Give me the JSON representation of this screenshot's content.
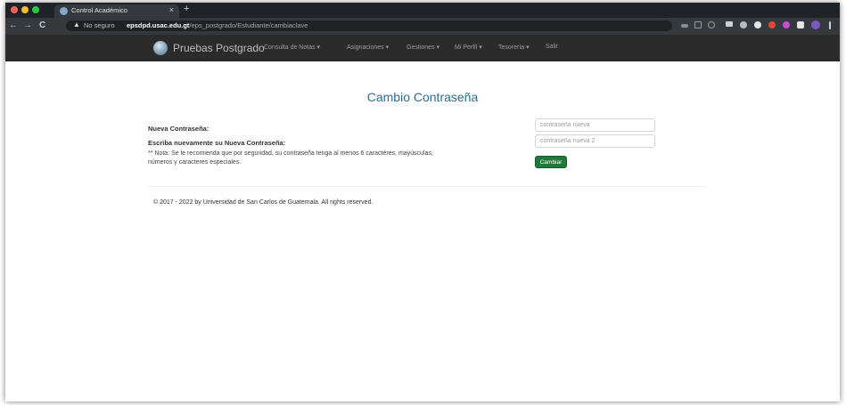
{
  "browser": {
    "tab_title": "Control Académico",
    "tab_close": "×",
    "new_tab": "+",
    "back": "←",
    "forward": "→",
    "reload": "C",
    "security_label": "No seguro",
    "url_host": "epsdpd.usac.edu.gt",
    "url_path": "/eps_postgrado/Estudiante/cambiaclave"
  },
  "navbar": {
    "brand": "Pruebas Postgrado",
    "menu": [
      {
        "label": "Consulta de Notas ▾"
      },
      {
        "label": "Asignaciones ▾"
      },
      {
        "label": "Gestiones ▾"
      },
      {
        "label": "Mi Perfil ▾"
      },
      {
        "label": "Tesorería ▾"
      },
      {
        "label": "Salir"
      }
    ]
  },
  "main": {
    "title": "Cambio Contraseña",
    "new_password_label": "Nueva Contraseña:",
    "repeat_password_label": "Escriba nuevamente su Nueva Contraseña:",
    "note": "** Nota: Se le recomienda que por seguridad, su contraseña tenga al menos 6 caractéres, mayúsculas, números y caracteres especiales.",
    "new_password_placeholder": "contraseña nueva",
    "repeat_password_placeholder": "contraseña nueva 2",
    "submit_label": "Cambiar"
  },
  "footer": {
    "text": "© 2017 - 2022 by Universidad de San Carlos de Guatemala. All rights reserved."
  },
  "colors": {
    "navbar_bg": "#2b2b2b",
    "title": "#2c6e8f",
    "button": "#1f7a3a"
  }
}
